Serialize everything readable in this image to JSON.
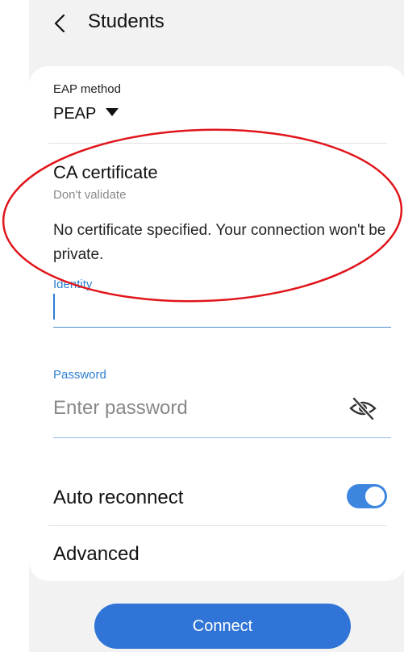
{
  "header": {
    "title": "Students",
    "back_icon": "chevron-left-icon"
  },
  "eap": {
    "label": "EAP method",
    "value": "PEAP",
    "dropdown_icon": "caret-down-icon"
  },
  "ca_certificate": {
    "title": "CA certificate",
    "value": "Don't validate",
    "warning": "No certificate specified. Your connection won't be private."
  },
  "identity": {
    "label": "Identity",
    "value": ""
  },
  "password": {
    "label": "Password",
    "placeholder": "Enter password",
    "visibility_icon": "eye-off-icon"
  },
  "auto_reconnect": {
    "label": "Auto reconnect",
    "enabled": true
  },
  "advanced": {
    "label": "Advanced"
  },
  "connect": {
    "label": "Connect"
  },
  "colors": {
    "accent": "#2f74d6",
    "field_label": "#2c7fd0",
    "annotation": "#e0151b",
    "background": "#f2f2f2"
  }
}
